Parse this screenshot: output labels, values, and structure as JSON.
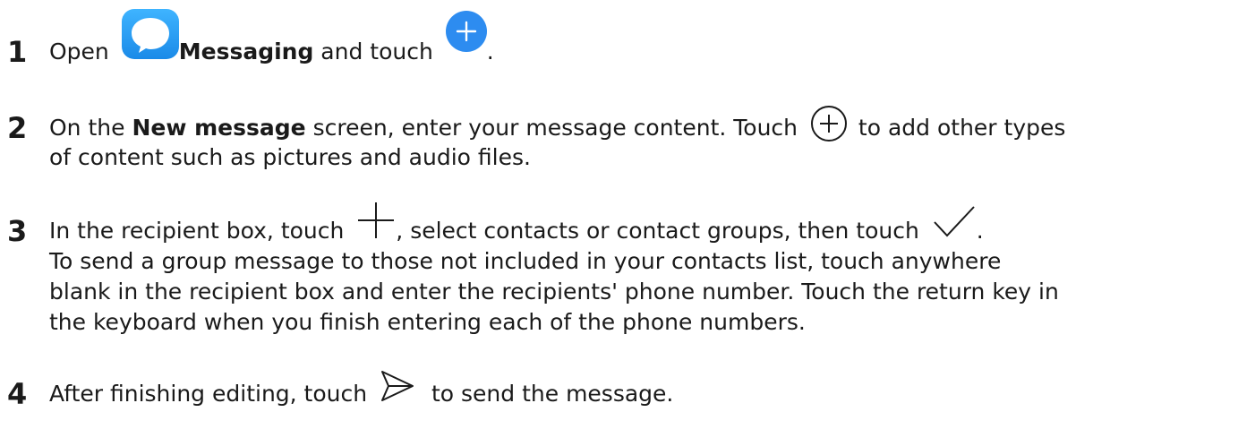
{
  "steps": [
    {
      "number": "1",
      "lines": [
        {
          "t1": "Open ",
          "bold": "Messaging",
          "t2": " and touch ",
          "t3": "."
        }
      ]
    },
    {
      "number": "2",
      "lines": [
        {
          "t1": "On the ",
          "bold": "New message",
          "t2": " screen, enter your message content. Touch ",
          "t3": " to add other types"
        },
        {
          "text": "of content such as pictures and audio files."
        }
      ]
    },
    {
      "number": "3",
      "lines": [
        {
          "t1": "In the recipient box, touch ",
          "t2": ", select contacts or contact groups, then touch ",
          "t3": "."
        },
        {
          "text": "To send a group message to those not included in your contacts list, touch anywhere"
        },
        {
          "text": "blank in the recipient box and enter the recipients' phone number. Touch the return key in"
        },
        {
          "text": "the keyboard when you finish entering each of the phone numbers."
        }
      ]
    },
    {
      "number": "4",
      "lines": [
        {
          "t1": "After finishing editing, touch ",
          "t2": " to send the message."
        }
      ]
    }
  ],
  "colors": {
    "accent": "#2d8cf0",
    "text": "#1a1a1a"
  },
  "icons": [
    "messaging-app-icon",
    "add-circle-filled-icon",
    "add-circle-outline-icon",
    "plus-icon",
    "checkmark-icon",
    "send-icon"
  ]
}
